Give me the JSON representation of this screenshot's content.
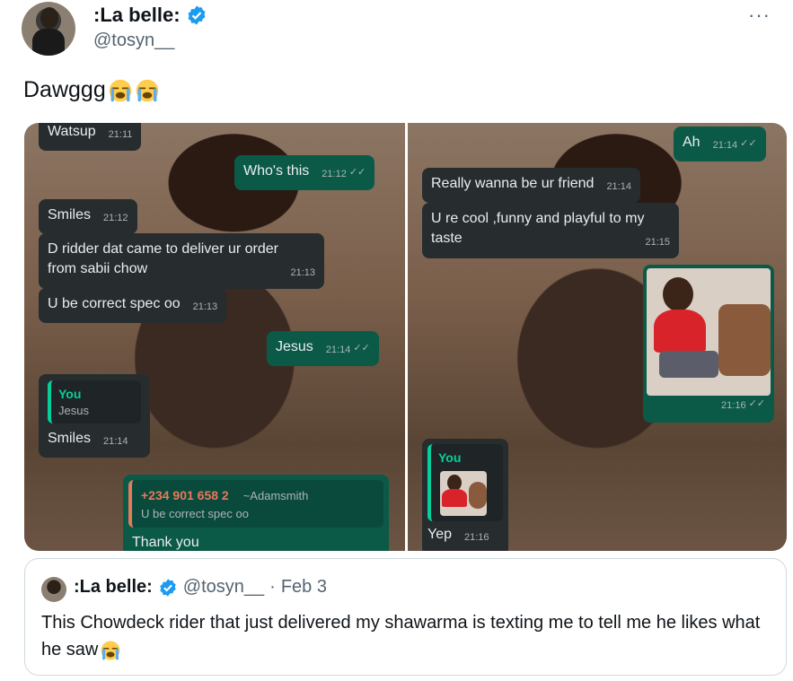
{
  "author": {
    "display_name": ":La belle:",
    "handle": "@tosyn__"
  },
  "more_label": "···",
  "tweet": {
    "text": "Dawggg",
    "emojis": [
      "loudly-crying-face",
      "loudly-crying-face"
    ]
  },
  "chat_left": {
    "messages": [
      {
        "text": "Watsup",
        "time": "21:11"
      },
      {
        "text": "Who's this",
        "time": "21:12"
      },
      {
        "text": "Smiles",
        "time": "21:12"
      },
      {
        "line1": "D ridder dat came to deliver ur order",
        "line2": "from sabii chow",
        "time": "21:13"
      },
      {
        "text": "U be correct spec oo",
        "time": "21:13"
      },
      {
        "text": "Jesus",
        "time": "21:14"
      },
      {
        "reply_name": "You",
        "reply_text": "Jesus",
        "text": "Smiles",
        "time": "21:14"
      },
      {
        "group_number": "+234 901 658 2",
        "group_alias": "~Adamsmith",
        "group_text": "U be correct spec oo",
        "text": "Thank you"
      }
    ]
  },
  "chat_right": {
    "messages": [
      {
        "text": "Ah",
        "time": "21:14"
      },
      {
        "text": "Really wanna be ur friend",
        "time": "21:14"
      },
      {
        "line1": "U re cool ,funny and playful to my",
        "line2": "taste",
        "time": "21:15"
      },
      {
        "time": "21:16"
      },
      {
        "reply_name": "You",
        "text": "Yep",
        "time": "21:16"
      }
    ]
  },
  "ticks": "✓✓",
  "quote": {
    "display_name": ":La belle:",
    "handle": "@tosyn__",
    "separator": "·",
    "date": "Feb 3",
    "text": "This Chowdeck rider that just delivered my shawarma is texting me to tell me he likes what he saw"
  },
  "colors": {
    "verified": "#1d9bf0",
    "outgoing_bubble": "#0b5a48",
    "incoming_bubble": "#272c2f",
    "reply_accent": "#06cf9c"
  }
}
